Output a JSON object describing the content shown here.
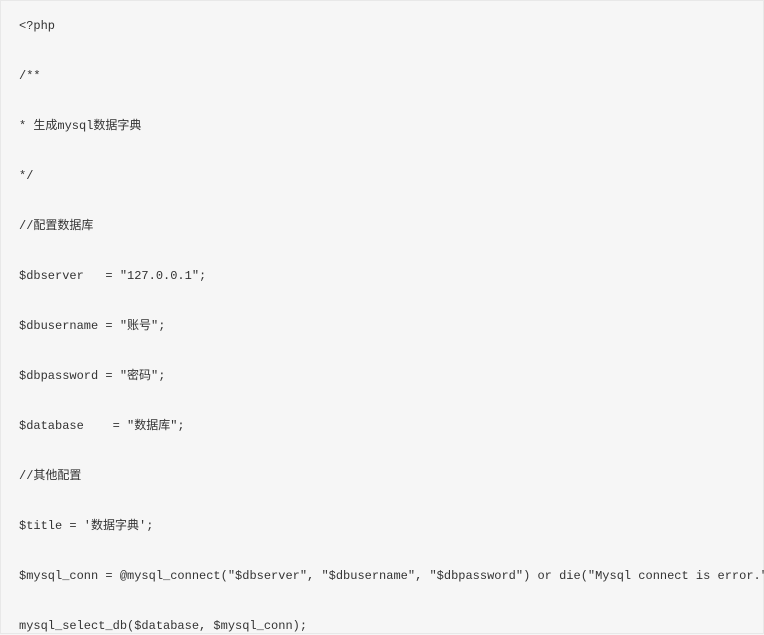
{
  "code": {
    "lines": [
      "<?php",
      "/**",
      "* 生成mysql数据字典",
      "*/",
      "//配置数据库",
      "$dbserver   = \"127.0.0.1\";",
      "$dbusername = \"账号\";",
      "$dbpassword = \"密码\";",
      "$database    = \"数据库\";",
      "//其他配置",
      "$title = '数据字典';",
      "$mysql_conn = @mysql_connect(\"$dbserver\", \"$dbusername\", \"$dbpassword\") or die(\"Mysql connect is error.\");",
      "mysql_select_db($database, $mysql_conn);"
    ]
  }
}
